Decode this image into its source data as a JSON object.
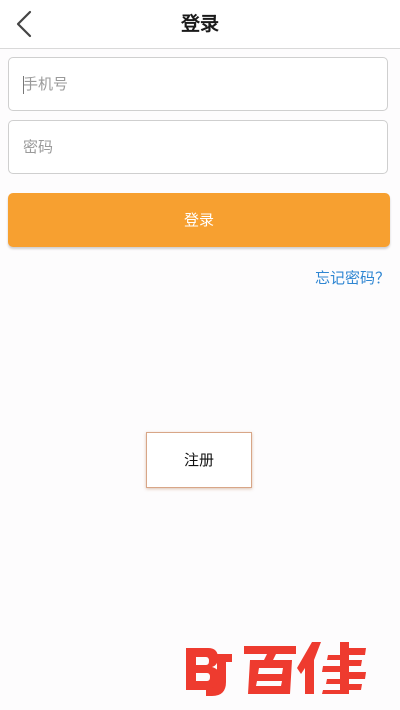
{
  "header": {
    "title": "登录",
    "back_icon": "chevron-left-icon"
  },
  "form": {
    "phone_placeholder": "手机号",
    "phone_value": "",
    "password_placeholder": "密码",
    "password_value": "",
    "login_label": "登录",
    "forgot_label": "忘记密码？",
    "register_label": "注册"
  },
  "watermark": {
    "text": "百佳",
    "mark": "BJ"
  },
  "colors": {
    "accent": "#f7a030",
    "link": "#2f86d2",
    "watermark": "#ee3b2f"
  }
}
